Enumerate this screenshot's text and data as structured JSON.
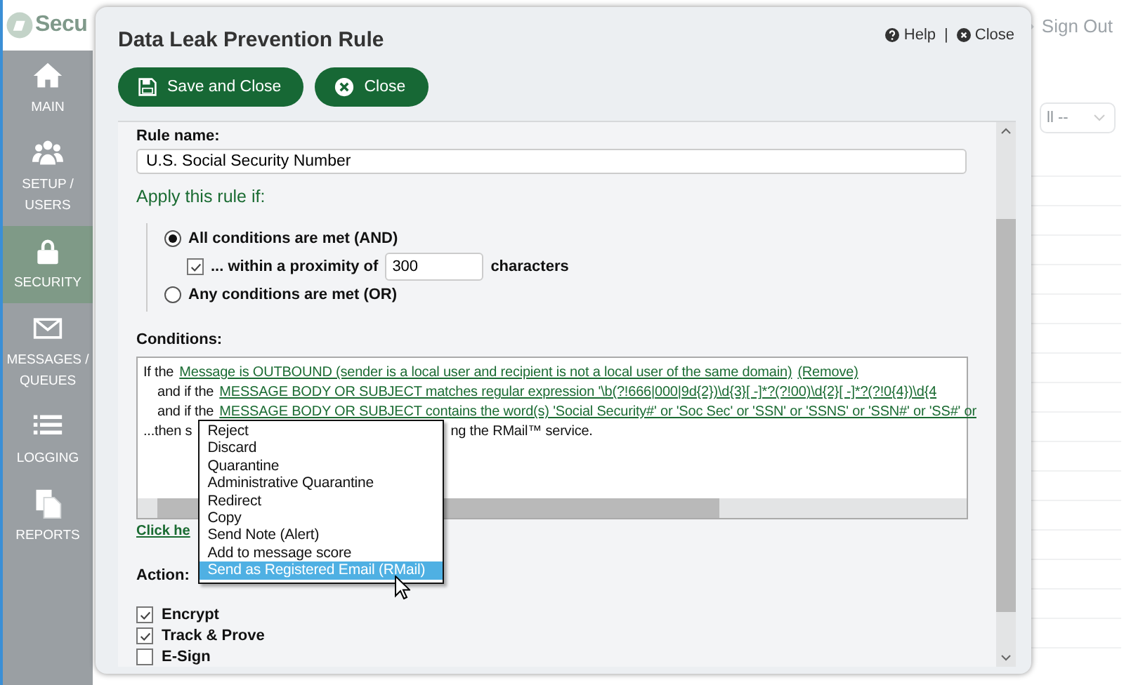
{
  "app": {
    "logo_text": "Secu",
    "sign_out": "Sign Out",
    "filter_value": "ll --"
  },
  "sidebar": {
    "items": [
      {
        "label": "MAIN",
        "selected": false
      },
      {
        "label": "SETUP / USERS",
        "selected": false
      },
      {
        "label": "SECURITY",
        "selected": true
      },
      {
        "label": "MESSAGES / QUEUES",
        "selected": false
      },
      {
        "label": "LOGGING",
        "selected": false
      },
      {
        "label": "REPORTS",
        "selected": false
      }
    ]
  },
  "dialog": {
    "title": "Data Leak Prevention Rule",
    "help": "Help",
    "separator": "|",
    "close_link": "Close",
    "buttons": [
      {
        "label": "Save and Close"
      },
      {
        "label": "Close"
      }
    ],
    "rule_name_label": "Rule name:",
    "rule_name": "U.S. Social Security Number",
    "apply_label": "Apply this rule if:",
    "options": [
      {
        "label": "All conditions are met (AND)",
        "selected": true
      },
      {
        "label": "Any conditions are met (OR)",
        "selected": false
      }
    ],
    "proximity": {
      "checked": true,
      "prefix": "... within a proximity of",
      "value": "300",
      "suffix": "characters"
    },
    "conditions_label": "Conditions:",
    "conditions": [
      {
        "indent": false,
        "parts": [
          {
            "kind": "text",
            "text": "If the"
          },
          {
            "kind": "link",
            "text": "Message is OUTBOUND (sender is a local user and recipient is not a local user of the same domain)"
          },
          {
            "kind": "link",
            "text": "(Remove)"
          }
        ]
      },
      {
        "indent": true,
        "parts": [
          {
            "kind": "text",
            "text": "and if the"
          },
          {
            "kind": "link",
            "text": "MESSAGE BODY OR SUBJECT matches regular expression '\\b(?!666|000|9d{2})\\d{3}[ -]*?(?!00)\\d{2}[ -]*?(?!0{4})\\d{4"
          }
        ]
      },
      {
        "indent": true,
        "parts": [
          {
            "kind": "text",
            "text": "and if the"
          },
          {
            "kind": "link",
            "text": "MESSAGE BODY OR SUBJECT contains the word(s) 'Social Security#' or 'Soc Sec' or 'SSN' or 'SSNS' or 'SSN#' or 'SS#' or"
          }
        ]
      },
      {
        "indent": false,
        "parts": [
          {
            "kind": "text",
            "text": "...then s"
          },
          {
            "kind": "gap"
          },
          {
            "kind": "text",
            "text": "ng the RMail™ service."
          }
        ]
      }
    ],
    "add_link": "Click he",
    "action_label": "Action:",
    "action_menu": [
      {
        "label": "Reject",
        "selected": false
      },
      {
        "label": "Discard",
        "selected": false
      },
      {
        "label": "Quarantine",
        "selected": false
      },
      {
        "label": "Administrative Quarantine",
        "selected": false
      },
      {
        "label": "Redirect",
        "selected": false
      },
      {
        "label": "Copy",
        "selected": false
      },
      {
        "label": "Send Note (Alert)",
        "selected": false
      },
      {
        "label": "Add to message score",
        "selected": false
      },
      {
        "label": "Send as Registered Email (RMail)",
        "selected": true
      }
    ],
    "options_checks": [
      {
        "label": "Encrypt",
        "checked": true
      },
      {
        "label": "Track & Prove",
        "checked": true
      },
      {
        "label": "E-Sign",
        "checked": false
      }
    ]
  }
}
